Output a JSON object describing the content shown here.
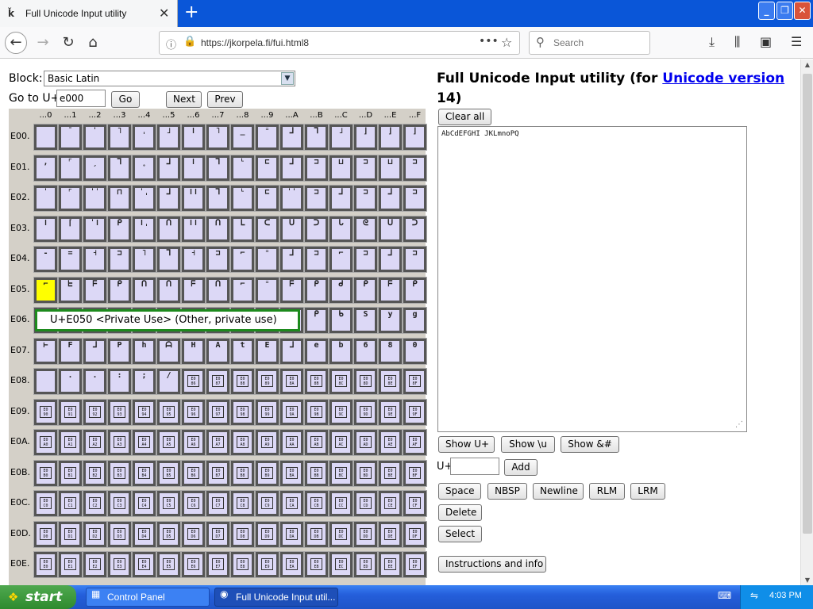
{
  "browser": {
    "tab_title": "Full Unicode Input utility",
    "url": "https://jkorpela.fi/fui.html8",
    "search_placeholder": "Search"
  },
  "form": {
    "block_label": "Block:",
    "block_value": "Basic Latin",
    "goto_label": "Go to U+",
    "goto_value": "e000",
    "go_button": "Go",
    "next_button": "Next",
    "prev_button": "Prev"
  },
  "grid": {
    "columns": [
      "...0",
      "...1",
      "...2",
      "...3",
      "...4",
      "...5",
      "...6",
      "...7",
      "...8",
      "...9",
      "...A",
      "...B",
      "...C",
      "...D",
      "...E",
      "...F"
    ],
    "rows": [
      "E00.",
      "E01.",
      "E02.",
      "E03.",
      "E04.",
      "E05.",
      "E06.",
      "E07.",
      "E08.",
      "E09.",
      "E0A.",
      "E0B.",
      "E0C.",
      "E0D.",
      "E0E."
    ],
    "glyph_rows": [
      [
        " ",
        "¯",
        "ˈ",
        "˥",
        "ˌ",
        "˩",
        "ǀ",
        "˥",
        "_",
        "⁼",
        "⅃",
        "⅂",
        "˩",
        "⌋",
        "⌋",
        "⌋"
      ],
      [
        ",",
        "⌜",
        "ˏ",
        "⅂",
        "˳",
        "⅃",
        "ǀ",
        "⅂",
        "ᴸ",
        "⊏",
        "⅃",
        "⊐",
        "⊔",
        "⊐",
        "⊔",
        "⊐"
      ],
      [
        "ˈ",
        "⌜",
        "ˈˈ",
        "⊓",
        "ˈˌ",
        "⅃",
        "ǀǀ",
        "⅂",
        "ᴸ",
        "⊏",
        "ˈˈ",
        "⊐",
        "⅃",
        "⊐",
        "⅃",
        "⊐"
      ],
      [
        "ǀ",
        "⌈",
        "ˈǀ",
        "ᑭ",
        "ǀˌ",
        "ᑎ",
        "ǀǀ",
        "ᑎ",
        "ᒪ",
        "ᑕ",
        "ᑌ",
        "ᑐ",
        "ᒐ",
        "ᘓ",
        "ᑌ",
        "ᑐ"
      ],
      [
        "-",
        "=",
        "˧",
        "⊐",
        "˥",
        "⅂",
        "˧",
        "⊐",
        "⌐",
        "⁼",
        "⅃",
        "⊐",
        "⌐",
        "⊐",
        "⅃",
        "⊐"
      ],
      [
        "⌐",
        "ᖶ",
        "ᖴ",
        "ᑭ",
        "ᑎ",
        "ᑎ",
        "ᖴ",
        "ᑎ",
        "⌐",
        "⁼",
        "ᖴ",
        "ᑭ",
        "ᑯ",
        "ᑭ",
        "ᖴ",
        "ᑭ"
      ],
      [
        "",
        "",
        "",
        "",
        "",
        "",
        "",
        "",
        "",
        "",
        "",
        "ᑭ",
        "ᑲ",
        "S",
        "y",
        "g"
      ],
      [
        "⊢",
        "F",
        "ᒧ",
        "P",
        "h",
        "ᗩ",
        "H",
        "A",
        "t",
        "E",
        "ᒧ",
        "e",
        "b",
        "6",
        "8",
        "0"
      ],
      [
        " ",
        ".",
        ".",
        ":",
        ";",
        "/",
        "PUA",
        "PUA",
        "PUA",
        "PUA",
        "PUA",
        "PUA",
        "PUA",
        "PUA",
        "PUA",
        "PUA"
      ]
    ],
    "pua_rows": [
      [
        "E086",
        "E087",
        "E088",
        "E089",
        "E08A",
        "E08B",
        "E08C",
        "E08D",
        "E08E",
        "E08F"
      ],
      [
        "E090",
        "E091",
        "E092",
        "E093",
        "E094",
        "E095",
        "E096",
        "E097",
        "E098",
        "E099",
        "E09A",
        "E09B",
        "E09C",
        "E09D",
        "E09E",
        "E09F"
      ],
      [
        "E0A0",
        "E0A1",
        "E0A2",
        "E0A3",
        "E0A4",
        "E0A5",
        "E0A6",
        "E0A7",
        "E0A8",
        "E0A9",
        "E0AA",
        "E0AB",
        "E0AC",
        "E0AD",
        "E0AE",
        "E0AF"
      ],
      [
        "E0B0",
        "E0B1",
        "E0B2",
        "E0B3",
        "E0B4",
        "E0B5",
        "E0B6",
        "E0B7",
        "E0B8",
        "E0B9",
        "E0BA",
        "E0BB",
        "E0BC",
        "E0BD",
        "E0BE",
        "E0BF"
      ],
      [
        "E0C0",
        "E0C1",
        "E0C2",
        "E0C3",
        "E0C4",
        "E0C5",
        "E0C6",
        "E0C7",
        "E0C8",
        "E0C9",
        "E0CA",
        "E0CB",
        "E0CC",
        "E0CD",
        "E0CE",
        "E0CF"
      ],
      [
        "E0D0",
        "E0D1",
        "E0D2",
        "E0D3",
        "E0D4",
        "E0D5",
        "E0D6",
        "E0D7",
        "E0D8",
        "E0D9",
        "E0DA",
        "E0DB",
        "E0DC",
        "E0DD",
        "E0DE",
        "E0DF"
      ],
      [
        "E0E0",
        "E0E1",
        "E0E2",
        "E0E3",
        "E0E4",
        "E0E5",
        "E0E6",
        "E0E7",
        "E0E8",
        "E0E9",
        "E0EA",
        "E0EB",
        "E0EC",
        "E0ED",
        "E0EE",
        "E0EF"
      ]
    ],
    "tooltip": "U+E050 <Private Use> (Other, private use)"
  },
  "panel": {
    "title_prefix": "Full Unicode Input utility (for ",
    "title_link": "Unicode version",
    "title_suffix": "14)",
    "clear_all": "Clear all",
    "textarea_value": "AbCdEFGHI JKLmnoPQ",
    "show_uplus": "Show U+",
    "show_backslash_u": "Show \\u",
    "show_amp": "Show &#",
    "uplus_label": "U+",
    "add_button": "Add",
    "space": "Space",
    "nbsp": "NBSP",
    "newline": "Newline",
    "rlm": "RLM",
    "lrm": "LRM",
    "delete": "Delete",
    "select": "Select",
    "instructions": "Instructions and info"
  },
  "taskbar": {
    "start": "start",
    "tasks": [
      "Control Panel",
      "Full Unicode Input util..."
    ],
    "clock": "4:03 PM"
  }
}
